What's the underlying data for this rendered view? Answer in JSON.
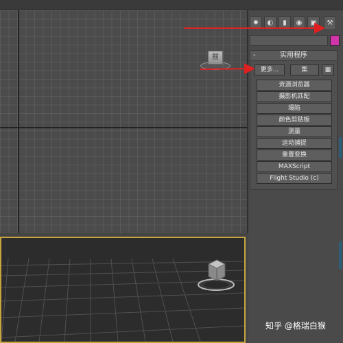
{
  "viewports": {
    "front": {
      "viewcube_label": "前"
    },
    "perspective": {}
  },
  "command_panel": {
    "tab_icons": [
      "sun-icon",
      "display-icon",
      "motion-icon",
      "hierarchy-icon",
      "modify-icon",
      "utilities-hammer-icon"
    ],
    "color_swatch": "#d133a8",
    "rollout": {
      "collapse_symbol": "-",
      "title": "实用程序",
      "more_button": "更多...",
      "sets_button": "集",
      "utilities": [
        "资源浏览器",
        "摄影机匹配",
        "塌陷",
        "颜色剪贴板",
        "测量",
        "运动捕捉",
        "重置变换",
        "MAXScript",
        "Flight Studio (c)"
      ]
    }
  },
  "annotations": {
    "arrow_color": "#e02020"
  },
  "watermark": "知乎 @格瑞白猴"
}
